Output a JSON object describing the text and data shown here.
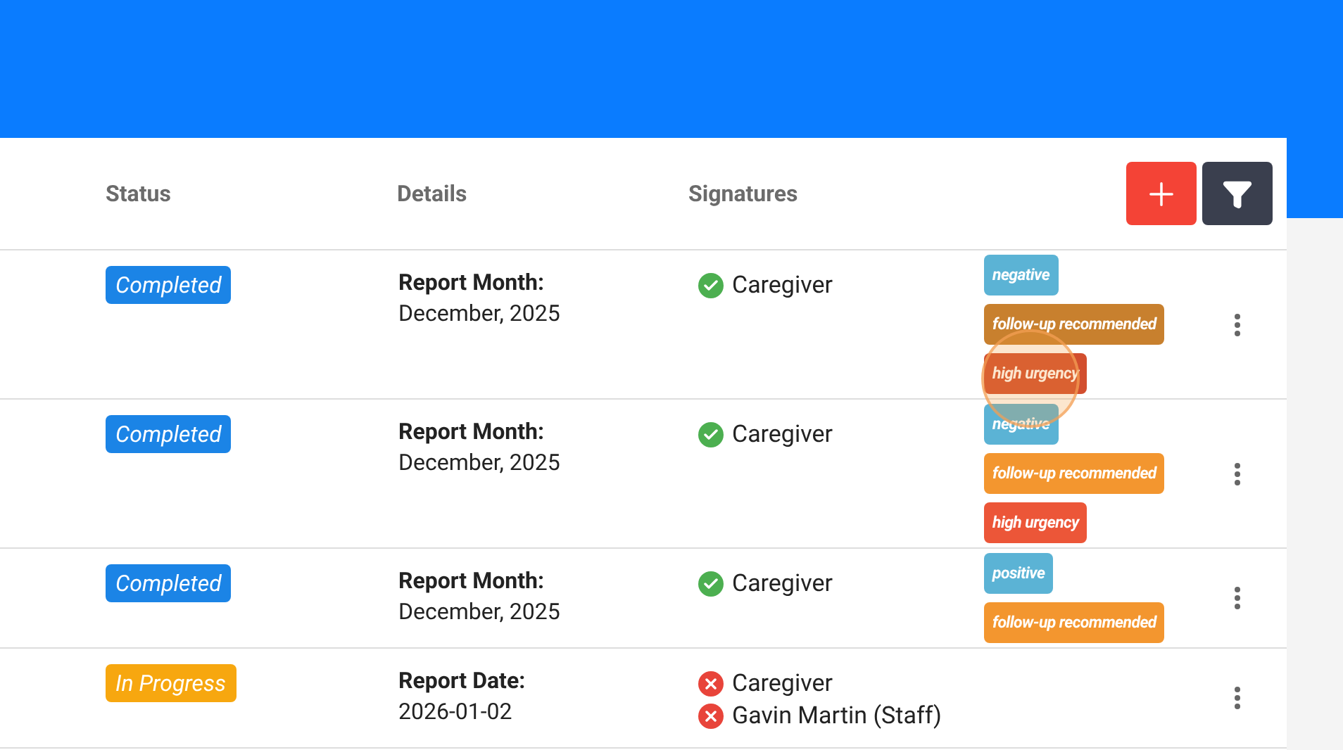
{
  "table": {
    "columns": [
      "Status",
      "Details",
      "Signatures"
    ],
    "rows": [
      {
        "status": {
          "label": "Completed",
          "kind": "completed"
        },
        "detail_label": "Report Month:",
        "detail_value": "December, 2025",
        "signatures": [
          {
            "name": "Caregiver",
            "signed": true
          }
        ],
        "tags": [
          {
            "label": "negative",
            "color": "#5bb3d5"
          },
          {
            "label": "follow-up recommended",
            "color": "#c8802e"
          },
          {
            "label": "high urgency",
            "color": "#d24e2e"
          }
        ]
      },
      {
        "status": {
          "label": "Completed",
          "kind": "completed"
        },
        "detail_label": "Report Month:",
        "detail_value": "December, 2025",
        "signatures": [
          {
            "name": "Caregiver",
            "signed": true
          }
        ],
        "tags": [
          {
            "label": "negative",
            "color": "#5bb3d5"
          },
          {
            "label": "follow-up recommended",
            "color": "#f3962f"
          },
          {
            "label": "high urgency",
            "color": "#ec5638"
          }
        ]
      },
      {
        "status": {
          "label": "Completed",
          "kind": "completed"
        },
        "detail_label": "Report Month:",
        "detail_value": "December, 2025",
        "signatures": [
          {
            "name": "Caregiver",
            "signed": true
          }
        ],
        "tags": [
          {
            "label": "positive",
            "color": "#5bb3d5"
          },
          {
            "label": "follow-up recommended",
            "color": "#f3962f"
          }
        ]
      },
      {
        "status": {
          "label": "In Progress",
          "kind": "in_progress"
        },
        "detail_label": "Report Date:",
        "detail_value": "2026-01-02",
        "signatures": [
          {
            "name": "Caregiver",
            "signed": false
          },
          {
            "name": "Gavin Martin (Staff)",
            "signed": false
          }
        ],
        "tags": []
      }
    ]
  }
}
